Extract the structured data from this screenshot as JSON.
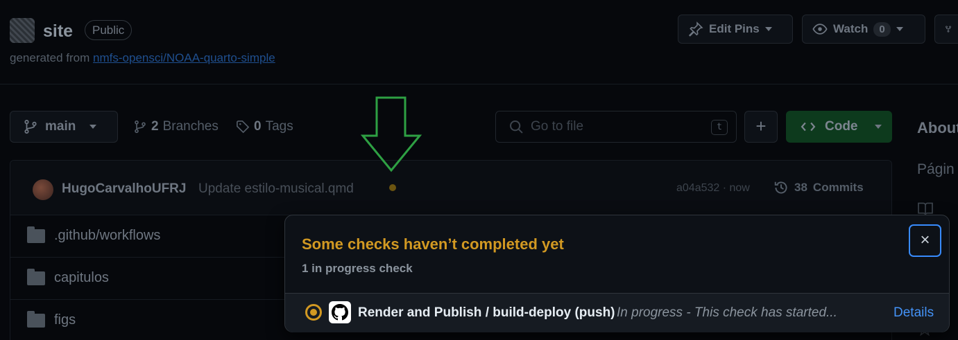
{
  "repo": {
    "name": "site",
    "visibility": "Public",
    "generated_prefix": "generated from",
    "template_link": "nmfs-opensci/NOAA-quarto-simple"
  },
  "header_actions": {
    "edit_pins": "Edit Pins",
    "watch": "Watch",
    "watch_count": "0"
  },
  "toolbar": {
    "branch": "main",
    "branches_count": "2",
    "branches_label": "Branches",
    "tags_count": "0",
    "tags_label": "Tags",
    "search_placeholder": "Go to file",
    "search_shortcut": "t",
    "add_label": "+",
    "code_label": "Code"
  },
  "sidebar": {
    "about": "About",
    "description": "Págin"
  },
  "latest_commit": {
    "author": "HugoCarvalhoUFRJ",
    "message": "Update estilo-musical.qmd",
    "sha_time": "a04a532 · now",
    "commits_count": "38",
    "commits_label": "Commits"
  },
  "files": [
    {
      "name": ".github/workflows"
    },
    {
      "name": "capitulos"
    },
    {
      "name": "figs"
    }
  ],
  "checks_popover": {
    "title": "Some checks haven’t completed yet",
    "subtitle": "1 in progress check",
    "close_label": "×",
    "check": {
      "name": "Render and Publish / build-deploy (push)",
      "status": "In progress - This check has started...",
      "details_label": "Details"
    }
  },
  "colors": {
    "warning": "#d29922",
    "link": "#4493f8",
    "annotation_arrow": "#2ea043",
    "focus_ring": "#388bfd"
  }
}
